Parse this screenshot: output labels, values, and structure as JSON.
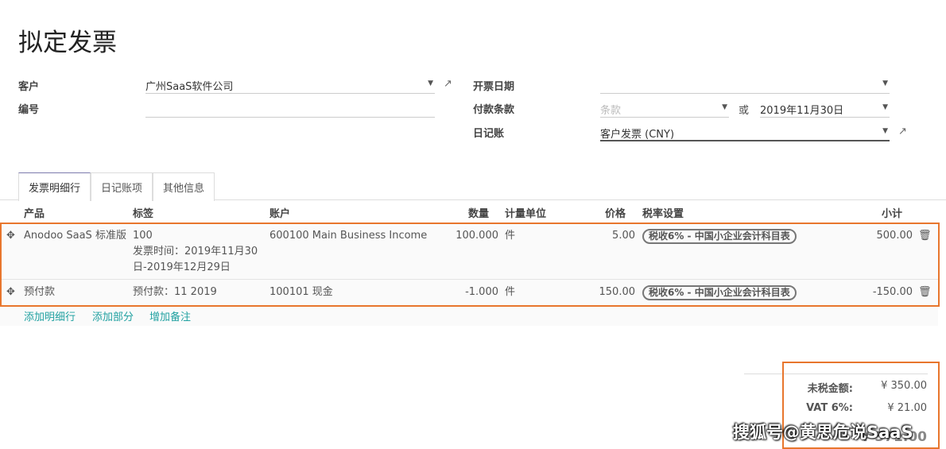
{
  "title": "拟定发票",
  "form": {
    "customer_label": "客户",
    "customer_value": "广州SaaS软件公司",
    "number_label": "编号",
    "number_value": "",
    "invoice_date_label": "开票日期",
    "invoice_date_value": "",
    "payment_terms_label": "付款条款",
    "payment_terms_placeholder": "条款",
    "or_label": "或",
    "due_date_value": "2019年11月30日",
    "journal_label": "日记账",
    "journal_value": "客户发票 (CNY)"
  },
  "tabs": [
    "发票明细行",
    "日记账项",
    "其他信息"
  ],
  "columns": [
    "产品",
    "标签",
    "账户",
    "数量",
    "计量单位",
    "价格",
    "税率设置",
    "小计"
  ],
  "lines": [
    {
      "product": "Anodoo SaaS 标准版",
      "label": [
        "100",
        "发票时间：2019年11月30",
        "日-2019年12月29日"
      ],
      "account": "600100 Main Business Income",
      "qty": "100.000",
      "uom": "件",
      "price": "5.00",
      "tax": "税收6% - 中国小企业会计科目表",
      "subtotal": "500.00"
    },
    {
      "product": "预付款",
      "label": [
        "预付款：11 2019"
      ],
      "account": "100101 现金",
      "qty": "-1.000",
      "uom": "件",
      "price": "150.00",
      "tax": "税收6% - 中国小企业会计科目表",
      "subtotal": "-150.00"
    }
  ],
  "actions": [
    "添加明细行",
    "添加部分",
    "增加备注"
  ],
  "totals": {
    "untaxed_label": "未税金额:",
    "untaxed_value": "¥ 350.00",
    "vat_label": "VAT 6%:",
    "vat_value": "¥ 21.00",
    "total_value": "¥ 371.00"
  },
  "watermark": "搜狐号@黄思危说SaaS",
  "colors": {
    "highlight": "#e8762d",
    "link": "#21a1a1"
  }
}
